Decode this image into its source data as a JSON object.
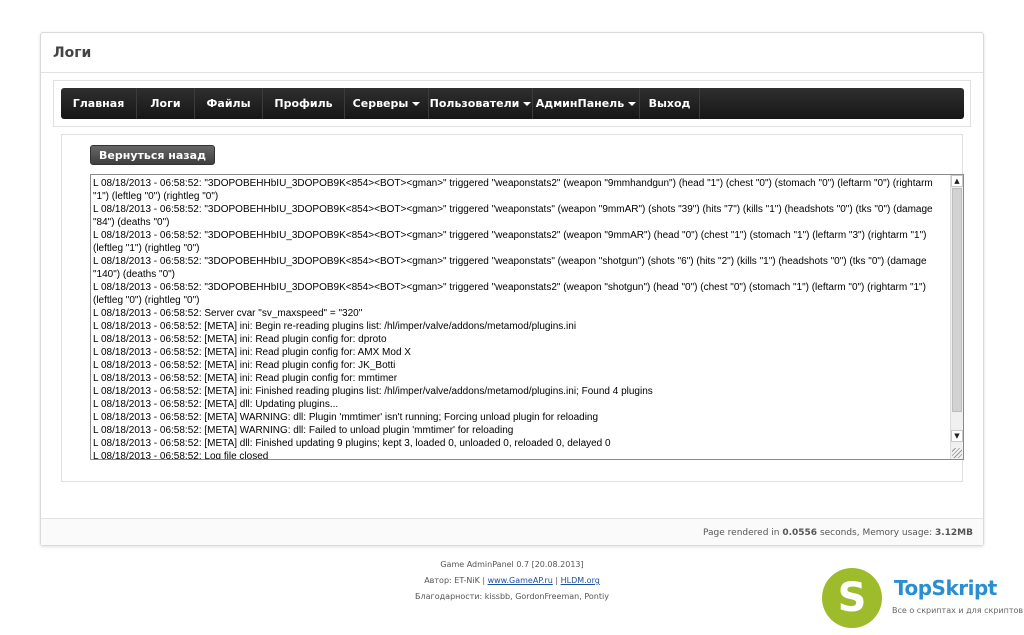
{
  "page": {
    "title": "Логи",
    "nav": [
      {
        "label": "Главная",
        "dropdown": false
      },
      {
        "label": "Логи",
        "dropdown": false
      },
      {
        "label": "Файлы",
        "dropdown": false
      },
      {
        "label": "Профиль",
        "dropdown": false
      },
      {
        "label": "Серверы",
        "dropdown": true
      },
      {
        "label": "Пользователи",
        "dropdown": true
      },
      {
        "label": "АдминПанель",
        "dropdown": true
      },
      {
        "label": "Выход",
        "dropdown": false
      }
    ],
    "back_button": "Вернуться назад",
    "log_lines": [
      "L 08/18/2013 - 06:58:52: \"3DOPOBEHHbIU_3DOPOB9K<854><BOT><gman>\" triggered \"weaponstats2\" (weapon \"9mmhandgun\") (head \"1\") (chest \"0\") (stomach \"0\") (leftarm \"0\") (rightarm \"1\") (leftleg \"0\") (rightleg \"0\")",
      "L 08/18/2013 - 06:58:52: \"3DOPOBEHHbIU_3DOPOB9K<854><BOT><gman>\" triggered \"weaponstats\" (weapon \"9mmAR\") (shots \"39\") (hits \"7\") (kills \"1\") (headshots \"0\") (tks \"0\") (damage \"84\") (deaths \"0\")",
      "L 08/18/2013 - 06:58:52: \"3DOPOBEHHbIU_3DOPOB9K<854><BOT><gman>\" triggered \"weaponstats2\" (weapon \"9mmAR\") (head \"0\") (chest \"1\") (stomach \"1\") (leftarm \"3\") (rightarm \"1\") (leftleg \"1\") (rightleg \"0\")",
      "L 08/18/2013 - 06:58:52: \"3DOPOBEHHbIU_3DOPOB9K<854><BOT><gman>\" triggered \"weaponstats\" (weapon \"shotgun\") (shots \"6\") (hits \"2\") (kills \"1\") (headshots \"0\") (tks \"0\") (damage \"140\") (deaths \"0\")",
      "L 08/18/2013 - 06:58:52: \"3DOPOBEHHbIU_3DOPOB9K<854><BOT><gman>\" triggered \"weaponstats2\" (weapon \"shotgun\") (head \"0\") (chest \"0\") (stomach \"1\") (leftarm \"0\") (rightarm \"1\") (leftleg \"0\") (rightleg \"0\")",
      "L 08/18/2013 - 06:58:52: Server cvar \"sv_maxspeed\" = \"320\"",
      "L 08/18/2013 - 06:58:52: [META] ini: Begin re-reading plugins list: /hl/imper/valve/addons/metamod/plugins.ini",
      "L 08/18/2013 - 06:58:52: [META] ini: Read plugin config for: dproto",
      "L 08/18/2013 - 06:58:52: [META] ini: Read plugin config for: AMX Mod X",
      "L 08/18/2013 - 06:58:52: [META] ini: Read plugin config for: JK_Botti",
      "L 08/18/2013 - 06:58:52: [META] ini: Read plugin config for: mmtimer",
      "L 08/18/2013 - 06:58:52: [META] ini: Finished reading plugins list: /hl/imper/valve/addons/metamod/plugins.ini; Found 4 plugins",
      "L 08/18/2013 - 06:58:52: [META] dll: Updating plugins...",
      "L 08/18/2013 - 06:58:52: [META] WARNING: dll: Plugin 'mmtimer' isn't running; Forcing unload plugin for reloading",
      "L 08/18/2013 - 06:58:52: [META] WARNING: dll: Failed to unload plugin 'mmtimer' for reloading",
      "L 08/18/2013 - 06:58:52: [META] dll: Finished updating 9 plugins; kept 3, loaded 0, unloaded 0, reloaded 0, delayed 0",
      "L 08/18/2013 - 06:58:52: Log file closed"
    ],
    "footer": {
      "rendered_prefix": "Page rendered in ",
      "rendered_seconds": "0.0556",
      "rendered_mid": " seconds, Memory usage: ",
      "memory": "3.12MB"
    }
  },
  "credits": {
    "line1": "Game AdminPanel 0.7 [20.08.2013]",
    "author_prefix": "Автор: ET-NiK | ",
    "link1": "www.GameAP.ru",
    "sep": " | ",
    "link2": "HLDM.org",
    "line3": "Благодарности: kissbb, GordonFreeman, Pontiy"
  },
  "logo": {
    "letter": "S",
    "name": "TopSkript",
    "tagline": "Все о скриптах и для скриптов...",
    "brand_color": "#9dbb2a",
    "name_color": "#2a8fd0"
  }
}
